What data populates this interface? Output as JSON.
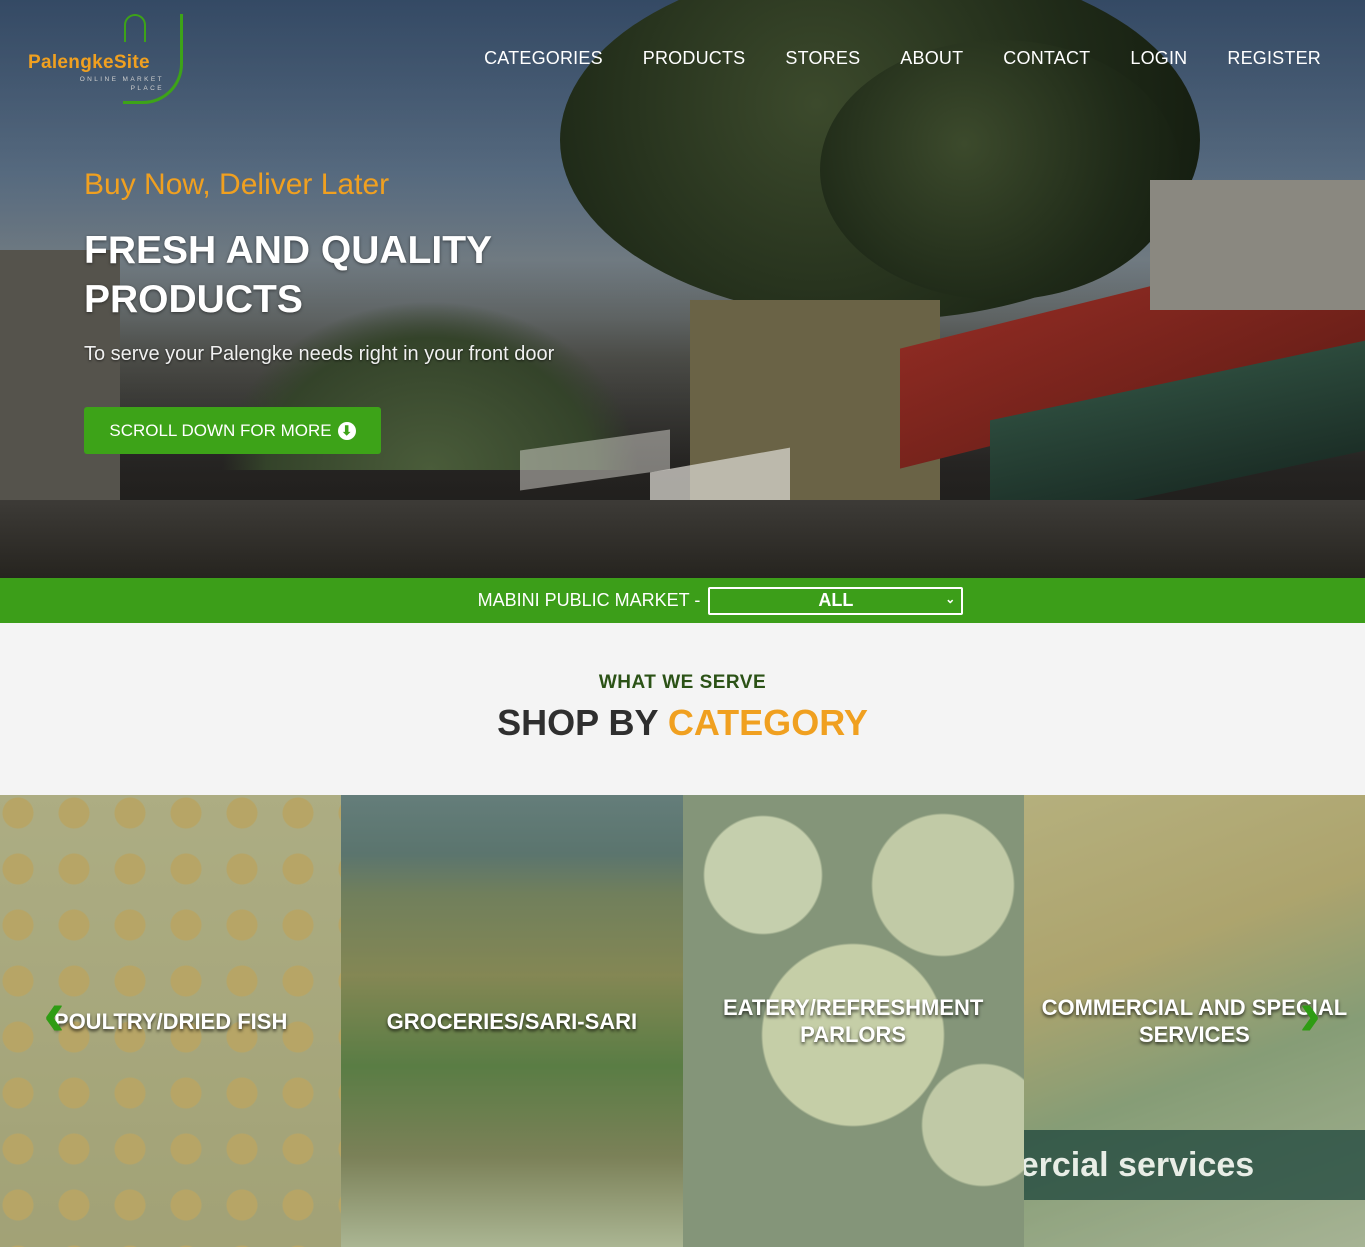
{
  "brand": {
    "name": "PalengkeSite",
    "subtitle": "ONLINE MARKET PLACE"
  },
  "nav": {
    "items": [
      {
        "label": "CATEGORIES"
      },
      {
        "label": "PRODUCTS"
      },
      {
        "label": "STORES"
      },
      {
        "label": "ABOUT"
      },
      {
        "label": "CONTACT"
      },
      {
        "label": "LOGIN"
      },
      {
        "label": "REGISTER"
      }
    ]
  },
  "hero": {
    "tagline": "Buy Now, Deliver Later",
    "headline": "FRESH AND QUALITY PRODUCTS",
    "subline": "To serve your Palengke needs right in your front door",
    "cta_label": "SCROLL DOWN FOR MORE",
    "cta_icon": "arrow-circle-down-icon"
  },
  "market": {
    "label": "MABINI PUBLIC MARKET -",
    "selected": "ALL"
  },
  "categories_section": {
    "eyebrow": "WHAT WE SERVE",
    "title_main": "SHOP BY",
    "title_accent": "CATEGORY",
    "cards": [
      {
        "title": "POULTRY/DRIED FISH"
      },
      {
        "title": "GROCERIES/SARI-SARI"
      },
      {
        "title": "EATERY/REFRESHMENT PARLORS"
      },
      {
        "title": "COMMERCIAL AND SPECIAL SERVICES",
        "image_text": "ercial services"
      }
    ]
  },
  "colors": {
    "brand_green": "#3c9e19",
    "brand_orange": "#f0a020",
    "dark_green_text": "#2b5216"
  }
}
